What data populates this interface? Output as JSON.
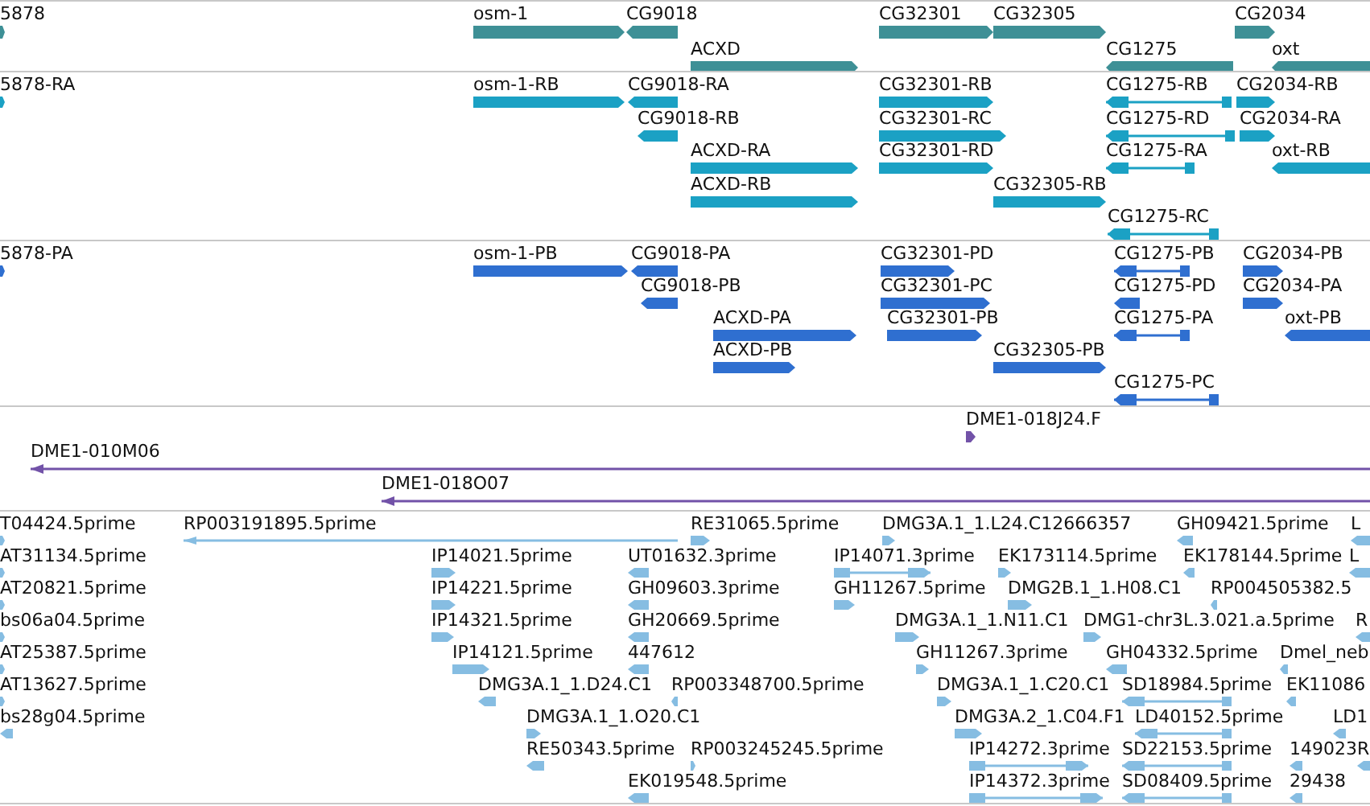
{
  "tracks": [
    {
      "kind": "gene",
      "color": "#3e9096",
      "features": [
        {
          "label": "5878",
          "reverse": false,
          "kind": "block"
        },
        {
          "label": "osm-1",
          "reverse": false,
          "kind": "block"
        },
        {
          "label": "CG9018",
          "reverse": true,
          "kind": "block"
        },
        {
          "label": "CG32301",
          "reverse": false,
          "kind": "block"
        },
        {
          "label": "CG32305",
          "reverse": false,
          "kind": "block"
        },
        {
          "label": "CG2034",
          "reverse": false,
          "kind": "block"
        },
        {
          "label": "ACXD",
          "reverse": false,
          "kind": "block"
        },
        {
          "label": "CG1275",
          "reverse": true,
          "kind": "block"
        },
        {
          "label": "oxt",
          "reverse": true,
          "kind": "block"
        }
      ]
    },
    {
      "kind": "transcript",
      "color": "#1ba1c4",
      "features": [
        {
          "label": "5878-RA",
          "reverse": false,
          "kind": "block"
        },
        {
          "label": "osm-1-RB",
          "reverse": false,
          "kind": "block"
        },
        {
          "label": "CG9018-RA",
          "reverse": true,
          "kind": "block"
        },
        {
          "label": "CG32301-RB",
          "reverse": false,
          "kind": "block"
        },
        {
          "label": "CG1275-RB",
          "reverse": true,
          "kind": "spliced"
        },
        {
          "label": "CG2034-RB",
          "reverse": false,
          "kind": "block"
        },
        {
          "label": "CG9018-RB",
          "reverse": true,
          "kind": "block"
        },
        {
          "label": "CG32301-RC",
          "reverse": false,
          "kind": "block"
        },
        {
          "label": "CG1275-RD",
          "reverse": true,
          "kind": "spliced"
        },
        {
          "label": "CG2034-RA",
          "reverse": false,
          "kind": "block"
        },
        {
          "label": "ACXD-RA",
          "reverse": false,
          "kind": "block"
        },
        {
          "label": "CG32301-RD",
          "reverse": false,
          "kind": "block"
        },
        {
          "label": "CG1275-RA",
          "reverse": true,
          "kind": "spliced"
        },
        {
          "label": "oxt-RB",
          "reverse": true,
          "kind": "block"
        },
        {
          "label": "ACXD-RB",
          "reverse": false,
          "kind": "block"
        },
        {
          "label": "CG32305-RB",
          "reverse": false,
          "kind": "block"
        },
        {
          "label": "CG1275-RC",
          "reverse": true,
          "kind": "spliced"
        }
      ]
    },
    {
      "kind": "protein",
      "color": "#2f6fd0",
      "features": [
        {
          "label": "5878-PA",
          "reverse": false,
          "kind": "block"
        },
        {
          "label": "osm-1-PB",
          "reverse": false,
          "kind": "block"
        },
        {
          "label": "CG9018-PA",
          "reverse": true,
          "kind": "block"
        },
        {
          "label": "CG32301-PD",
          "reverse": false,
          "kind": "block"
        },
        {
          "label": "CG1275-PB",
          "reverse": true,
          "kind": "spliced"
        },
        {
          "label": "CG2034-PB",
          "reverse": false,
          "kind": "block"
        },
        {
          "label": "CG9018-PB",
          "reverse": true,
          "kind": "block"
        },
        {
          "label": "CG32301-PC",
          "reverse": false,
          "kind": "block"
        },
        {
          "label": "CG1275-PD",
          "reverse": true,
          "kind": "block"
        },
        {
          "label": "CG2034-PA",
          "reverse": false,
          "kind": "block"
        },
        {
          "label": "ACXD-PA",
          "reverse": false,
          "kind": "block"
        },
        {
          "label": "CG32301-PB",
          "reverse": false,
          "kind": "block"
        },
        {
          "label": "CG1275-PA",
          "reverse": true,
          "kind": "spliced"
        },
        {
          "label": "oxt-PB",
          "reverse": true,
          "kind": "block"
        },
        {
          "label": "ACXD-PB",
          "reverse": false,
          "kind": "block"
        },
        {
          "label": "CG32305-PB",
          "reverse": false,
          "kind": "block"
        },
        {
          "label": "CG1275-PC",
          "reverse": true,
          "kind": "spliced"
        }
      ]
    },
    {
      "kind": "clone",
      "color": "#7252a8",
      "features": [
        {
          "label": "DME1-018J24.F",
          "reverse": false,
          "kind": "block"
        },
        {
          "label": "DME1-010M06",
          "reverse": true,
          "kind": "line"
        },
        {
          "label": "DME1-018O07",
          "reverse": true,
          "kind": "line"
        }
      ]
    },
    {
      "kind": "est",
      "color": "#86bde2",
      "features": [
        {
          "label": "T04424.5prime",
          "reverse": false,
          "kind": "block"
        },
        {
          "label": "RP003191895.5prime",
          "reverse": true,
          "kind": "line"
        },
        {
          "label": "RE31065.5prime",
          "reverse": false,
          "kind": "block"
        },
        {
          "label": "DMG3A.1_1.L24.C12666357",
          "reverse": false,
          "kind": "block"
        },
        {
          "label": "GH09421.5prime",
          "reverse": true,
          "kind": "block"
        },
        {
          "label": "L",
          "reverse": true,
          "kind": "block"
        },
        {
          "label": "AT31134.5prime",
          "reverse": false,
          "kind": "block"
        },
        {
          "label": "IP14021.5prime",
          "reverse": false,
          "kind": "block"
        },
        {
          "label": "UT01632.3prime",
          "reverse": true,
          "kind": "block"
        },
        {
          "label": "IP14071.3prime",
          "reverse": false,
          "kind": "spliced"
        },
        {
          "label": "EK173114.5prime",
          "reverse": false,
          "kind": "block"
        },
        {
          "label": "EK178144.5prime",
          "reverse": true,
          "kind": "block"
        },
        {
          "label": "L",
          "reverse": true,
          "kind": "block"
        },
        {
          "label": "AT20821.5prime",
          "reverse": false,
          "kind": "block"
        },
        {
          "label": "IP14221.5prime",
          "reverse": false,
          "kind": "block"
        },
        {
          "label": "GH09603.3prime",
          "reverse": true,
          "kind": "block"
        },
        {
          "label": "GH11267.5prime",
          "reverse": false,
          "kind": "block"
        },
        {
          "label": "DMG2B.1_1.H08.C1",
          "reverse": false,
          "kind": "block"
        },
        {
          "label": "RP004505382.5",
          "reverse": true,
          "kind": "block"
        },
        {
          "label": "bs06a04.5prime",
          "reverse": false,
          "kind": "block"
        },
        {
          "label": "IP14321.5prime",
          "reverse": false,
          "kind": "block"
        },
        {
          "label": "GH20669.5prime",
          "reverse": true,
          "kind": "block"
        },
        {
          "label": "DMG3A.1_1.N11.C1",
          "reverse": false,
          "kind": "block"
        },
        {
          "label": "DMG1-chr3L.3.021.a.5prime",
          "reverse": false,
          "kind": "block"
        },
        {
          "label": "R",
          "reverse": true,
          "kind": "block"
        },
        {
          "label": "AT25387.5prime",
          "reverse": false,
          "kind": "block"
        },
        {
          "label": "IP14121.5prime",
          "reverse": false,
          "kind": "block"
        },
        {
          "label": "447612",
          "reverse": true,
          "kind": "block"
        },
        {
          "label": "GH11267.3prime",
          "reverse": false,
          "kind": "block"
        },
        {
          "label": "GH04332.5prime",
          "reverse": true,
          "kind": "block"
        },
        {
          "label": "Dmel_neb",
          "reverse": true,
          "kind": "block"
        },
        {
          "label": "AT13627.5prime",
          "reverse": false,
          "kind": "block"
        },
        {
          "label": "DMG3A.1_1.D24.C1",
          "reverse": true,
          "kind": "block"
        },
        {
          "label": "RP003348700.5prime",
          "reverse": true,
          "kind": "block"
        },
        {
          "label": "DMG3A.1_1.C20.C1",
          "reverse": false,
          "kind": "block"
        },
        {
          "label": "SD18984.5prime",
          "reverse": true,
          "kind": "spliced"
        },
        {
          "label": "EK11086",
          "reverse": true,
          "kind": "block"
        },
        {
          "label": "bs28g04.5prime",
          "reverse": true,
          "kind": "block"
        },
        {
          "label": "DMG3A.1_1.O20.C1",
          "reverse": false,
          "kind": "block"
        },
        {
          "label": "DMG3A.2_1.C04.F1",
          "reverse": false,
          "kind": "block"
        },
        {
          "label": "LD40152.5prime",
          "reverse": true,
          "kind": "spliced"
        },
        {
          "label": "LD1",
          "reverse": true,
          "kind": "block"
        },
        {
          "label": "RE50343.5prime",
          "reverse": true,
          "kind": "block"
        },
        {
          "label": "RP003245245.5prime",
          "reverse": false,
          "kind": "block"
        },
        {
          "label": "IP14272.3prime",
          "reverse": false,
          "kind": "spliced"
        },
        {
          "label": "SD22153.5prime",
          "reverse": true,
          "kind": "spliced"
        },
        {
          "label": "149023",
          "reverse": true,
          "kind": "block"
        },
        {
          "label": "R",
          "reverse": true,
          "kind": "block"
        },
        {
          "label": "EK019548.5prime",
          "reverse": true,
          "kind": "block"
        },
        {
          "label": "IP14372.3prime",
          "reverse": false,
          "kind": "spliced"
        },
        {
          "label": "SD08409.5prime",
          "reverse": true,
          "kind": "spliced"
        },
        {
          "label": "29438",
          "reverse": true,
          "kind": "block"
        }
      ]
    }
  ]
}
